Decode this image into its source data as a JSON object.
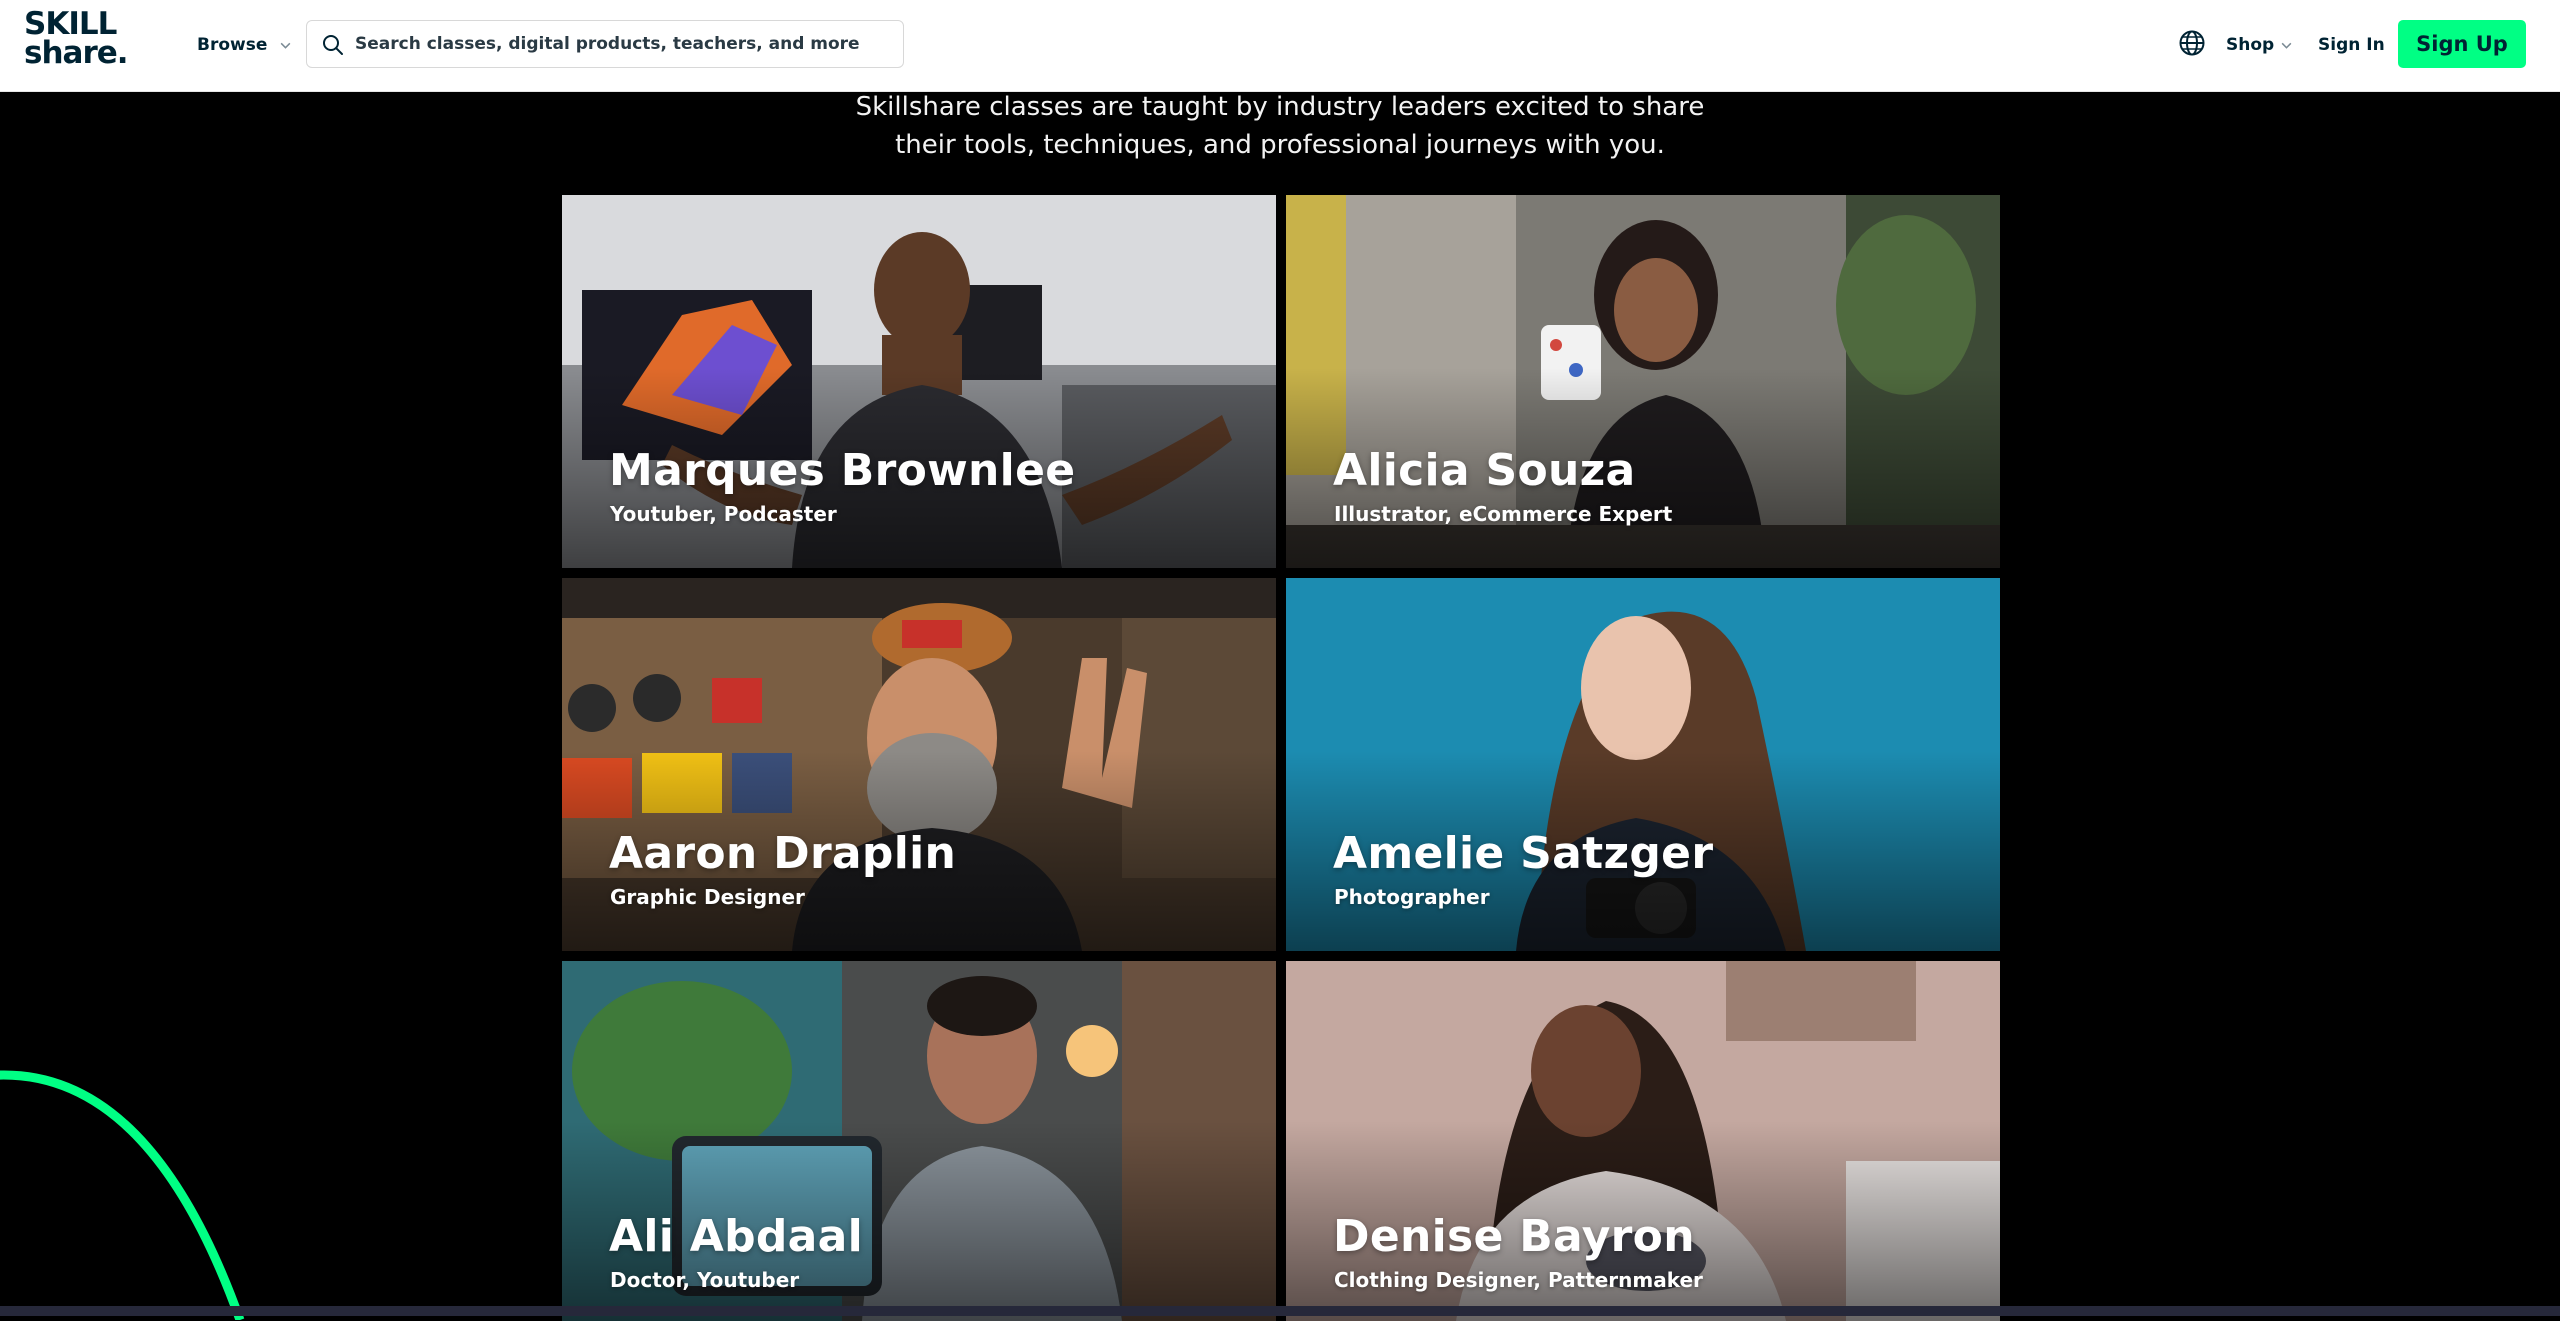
{
  "header": {
    "logo_line1": "SKILL",
    "logo_line2": "share.",
    "browse_label": "Browse",
    "search_placeholder": "Search classes, digital products, teachers, and more",
    "shop_label": "Shop",
    "signin_label": "Sign In",
    "signup_label": "Sign Up"
  },
  "hero": {
    "subtitle_line1": "Skillshare classes are taught by industry leaders excited to share",
    "subtitle_line2": "their tools, techniques, and professional journeys with you."
  },
  "teachers": [
    {
      "name": "Marques Brownlee",
      "role": "Youtuber, Podcaster"
    },
    {
      "name": "Alicia Souza",
      "role": "Illustrator, eCommerce Expert"
    },
    {
      "name": "Aaron Draplin",
      "role": "Graphic Designer"
    },
    {
      "name": "Amelie Satzger",
      "role": "Photographer"
    },
    {
      "name": "Ali Abdaal",
      "role": "Doctor, Youtuber"
    },
    {
      "name": "Denise Bayron",
      "role": "Clothing Designer, Patternmaker"
    }
  ],
  "colors": {
    "brand_green": "#00ff84",
    "text_dark": "#002333",
    "page_bg": "#000000"
  },
  "icons": [
    "search-icon",
    "globe-icon",
    "chevron-down-icon"
  ]
}
